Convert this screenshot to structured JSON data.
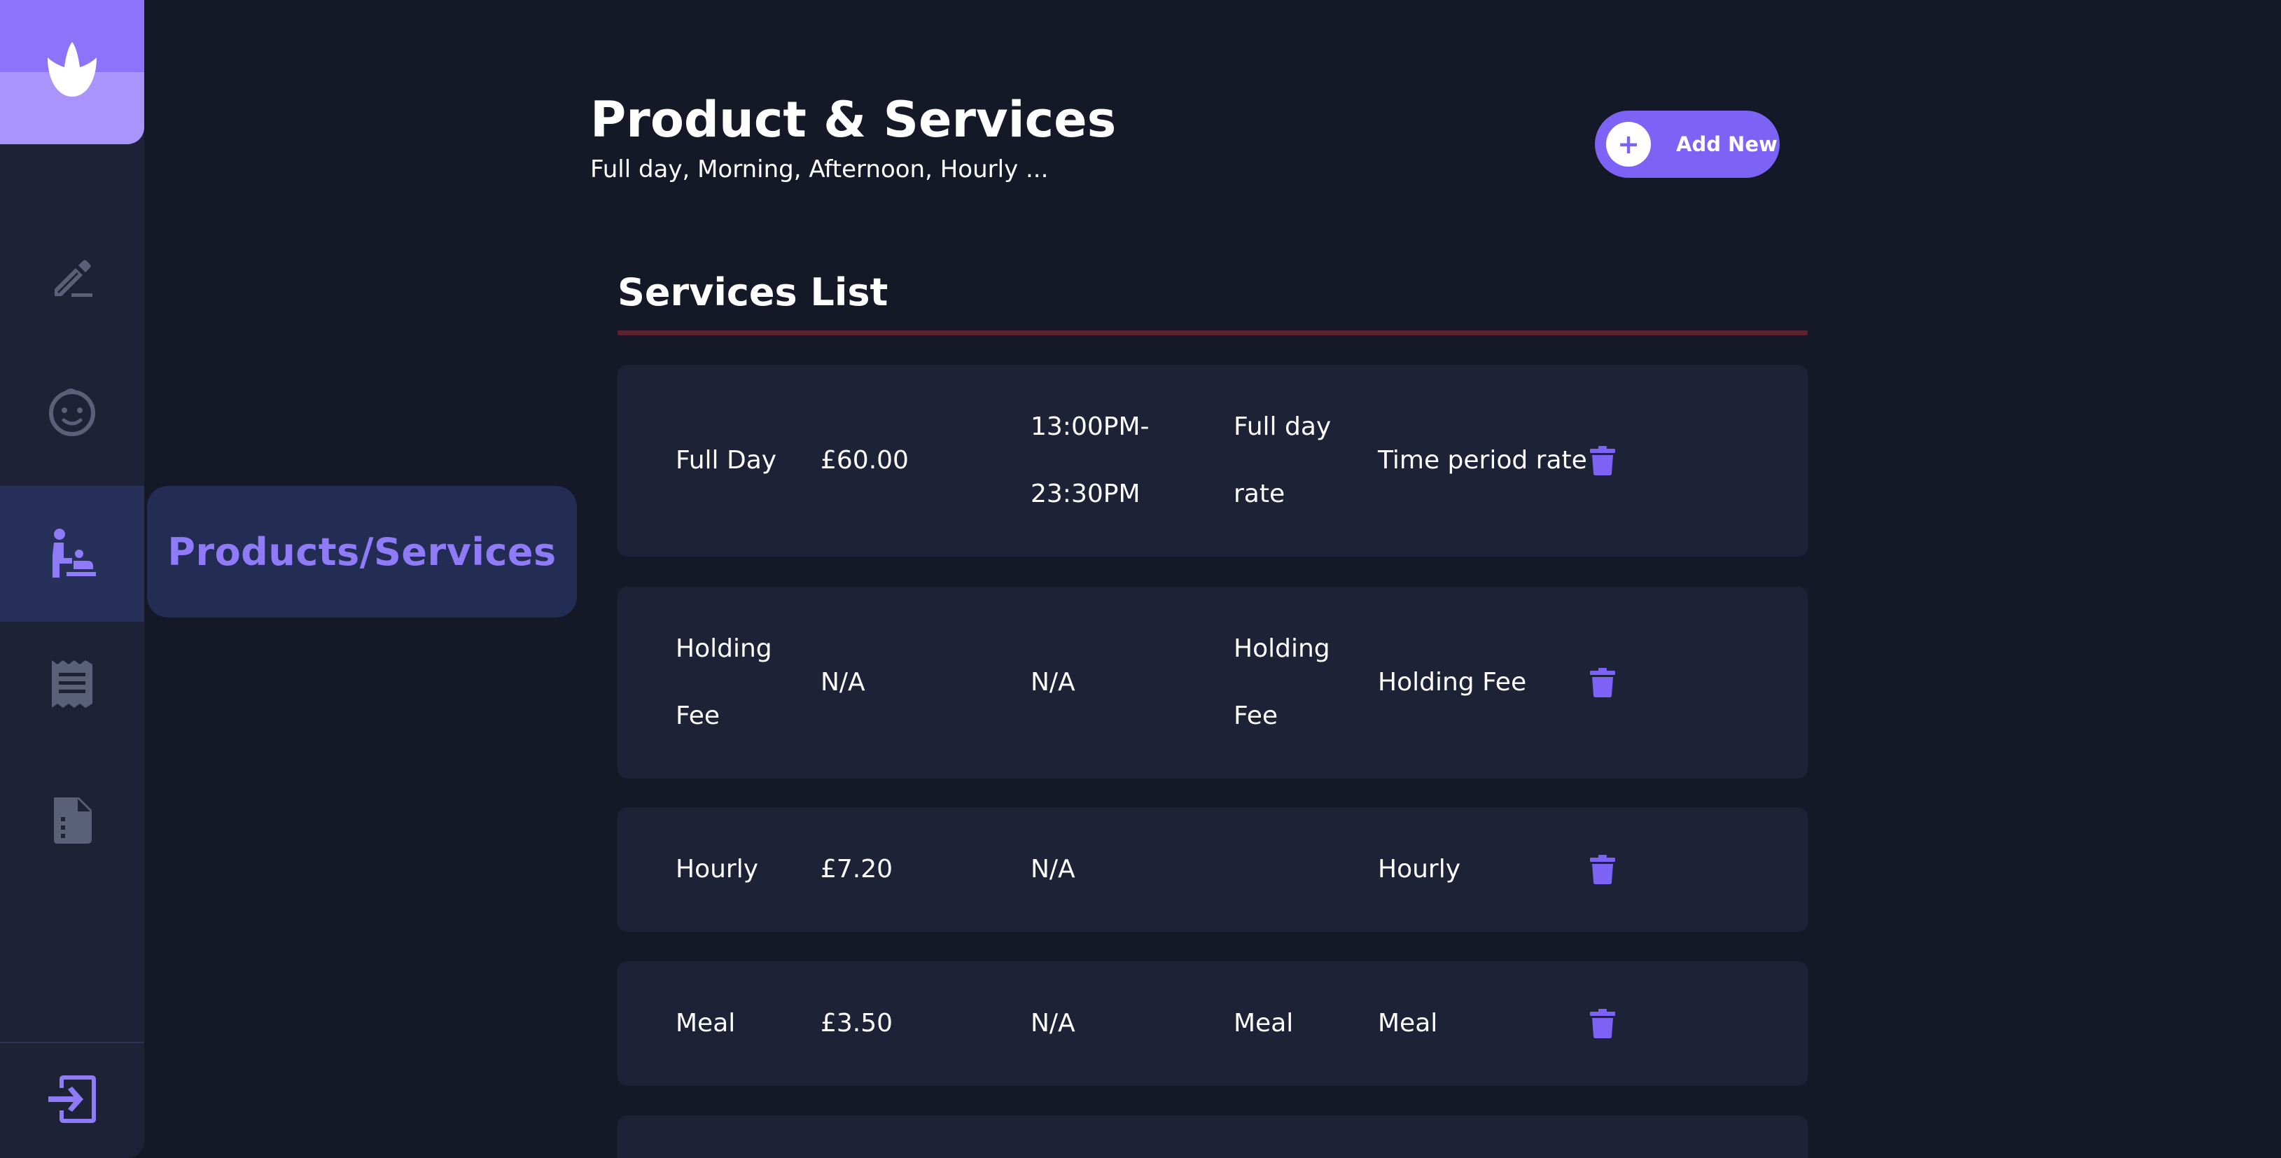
{
  "sidebar": {
    "logo_icon": "tulip-logo-icon",
    "items": [
      {
        "icon": "pencil-icon",
        "active": false
      },
      {
        "icon": "baby-face-icon",
        "active": false
      },
      {
        "icon": "childcare-icon",
        "active": true
      },
      {
        "icon": "receipt-icon",
        "active": false
      },
      {
        "icon": "document-icon",
        "active": false
      }
    ],
    "active_label": "Products/Services",
    "logout_icon": "logout-icon"
  },
  "header": {
    "title": "Product & Services",
    "subtitle": "Full day, Morning, Afternoon, Hourly ...",
    "add_icon": "+",
    "add_label": "Add New"
  },
  "services": {
    "title": "Services List",
    "rows": [
      {
        "name": "Full Day",
        "price": "£60.00",
        "time": "13:00PM-23:30PM",
        "type": "Full day rate",
        "rate": "Time period rate"
      },
      {
        "name": "Holding Fee",
        "price": "N/A",
        "time": "N/A",
        "type": "Holding Fee",
        "rate": "Holding Fee"
      },
      {
        "name": "Hourly",
        "price": "£7.20",
        "time": "N/A",
        "type": "",
        "rate": "Hourly"
      },
      {
        "name": "Meal",
        "price": "£3.50",
        "time": "N/A",
        "type": "Meal",
        "rate": "Meal"
      }
    ]
  },
  "colors": {
    "background": "#151827",
    "sidebar": "#1e2236",
    "accent": "#7c62f5",
    "row": "#1e2237",
    "divider": "#5a2230"
  }
}
